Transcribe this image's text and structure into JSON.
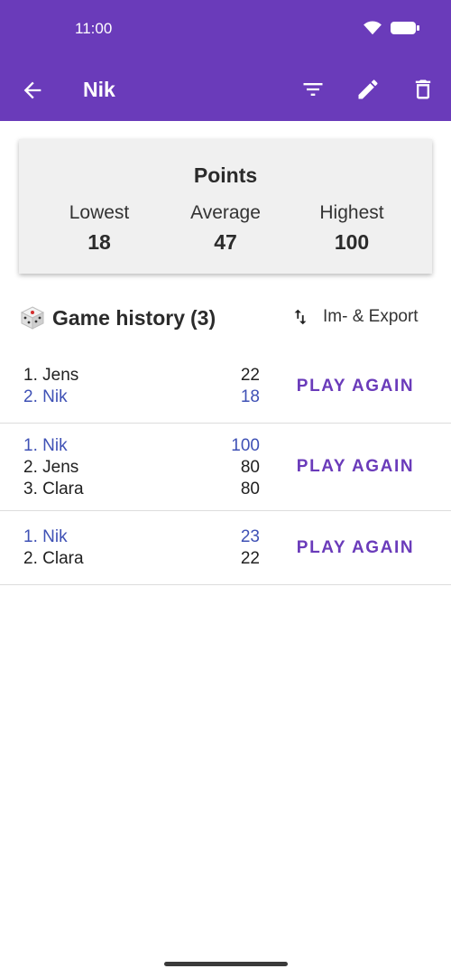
{
  "status_bar": {
    "time": "11:00"
  },
  "app_bar": {
    "title": "Nik"
  },
  "points_card": {
    "title": "Points",
    "stats": [
      {
        "label": "Lowest",
        "value": "18"
      },
      {
        "label": "Average",
        "value": "47"
      },
      {
        "label": "Highest",
        "value": "100"
      }
    ]
  },
  "history": {
    "title": "Game history",
    "count": "(3)",
    "export_label": "Im- & Export",
    "games": [
      {
        "rows": [
          {
            "name": "1. Jens",
            "score": "22",
            "highlight": false
          },
          {
            "name": "2. Nik",
            "score": "18",
            "highlight": true
          }
        ],
        "action": "PLAY AGAIN"
      },
      {
        "rows": [
          {
            "name": "1. Nik",
            "score": "100",
            "highlight": true
          },
          {
            "name": "2. Jens",
            "score": "80",
            "highlight": false
          },
          {
            "name": "3. Clara",
            "score": "80",
            "highlight": false
          }
        ],
        "action": "PLAY AGAIN"
      },
      {
        "rows": [
          {
            "name": "1. Nik",
            "score": "23",
            "highlight": true
          },
          {
            "name": "2. Clara",
            "score": "22",
            "highlight": false
          }
        ],
        "action": "PLAY AGAIN"
      }
    ]
  },
  "colors": {
    "primary": "#6a3bba",
    "highlight": "#3f51b5"
  },
  "icons": {
    "back": "arrow-back-icon",
    "filter": "filter-icon",
    "edit": "pencil-icon",
    "delete": "trash-icon",
    "dice": "dice-icon",
    "swap": "swap-vertical-icon"
  }
}
